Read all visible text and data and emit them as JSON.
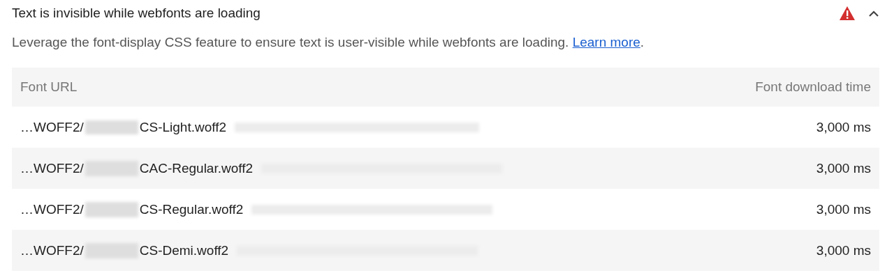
{
  "audit": {
    "title": "Text is invisible while webfonts are loading",
    "failed": true,
    "expanded": true
  },
  "description": {
    "text": "Leverage the font-display CSS feature to ensure text is user-visible while webfonts are loading.",
    "link": "Learn more",
    "after": "."
  },
  "table": {
    "columns": [
      "Font URL",
      "Font download time"
    ],
    "rows": [
      {
        "prefix": "…WOFF2/",
        "file": "CS-Light.woff2",
        "time": "3,000 ms"
      },
      {
        "prefix": "…WOFF2/",
        "file": "CAC-Regular.woff2",
        "time": "3,000 ms"
      },
      {
        "prefix": "…WOFF2/",
        "file": "CS-Regular.woff2",
        "time": "3,000 ms"
      },
      {
        "prefix": "…WOFF2/",
        "file": "CS-Demi.woff2",
        "time": "3,000 ms"
      }
    ]
  }
}
